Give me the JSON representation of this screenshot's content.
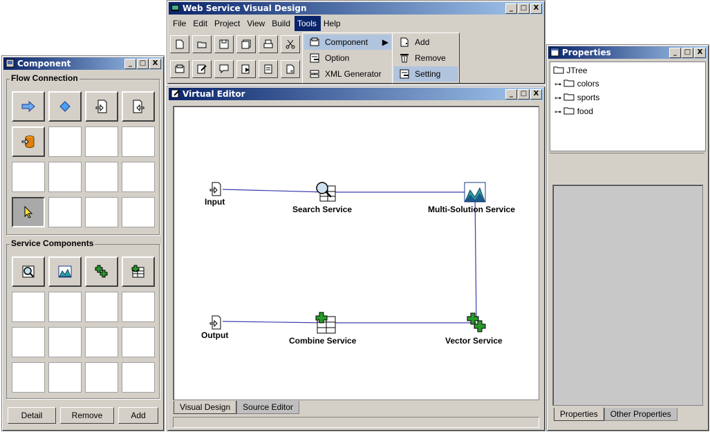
{
  "component_window": {
    "title": "Component",
    "flow_group_label": "Flow Connection",
    "service_group_label": "Service Components",
    "flow_icons": [
      "arrow-right-icon",
      "diamond-icon",
      "import-icon",
      "export-icon",
      "database-import-icon",
      "pointer-icon"
    ],
    "service_icons": [
      "search-service-icon",
      "multi-solution-icon",
      "vector-service-icon",
      "combine-service-icon"
    ],
    "buttons": {
      "detail": "Detail",
      "remove": "Remove",
      "add": "Add"
    }
  },
  "main_window": {
    "title": "Web Service Visual Design",
    "menu": [
      "File",
      "Edit",
      "Project",
      "View",
      "Build",
      "Tools",
      "Help"
    ],
    "active_menu": "Tools"
  },
  "tools_menu": {
    "items": [
      "Component",
      "Option",
      "XML Generator"
    ],
    "submenu": [
      "Add",
      "Remove",
      "Setting"
    ],
    "highlighted_item": "Component",
    "highlighted_subitem": "Setting"
  },
  "editor_window": {
    "title": "Virtual Editor",
    "tabs": [
      "Visual Design",
      "Source Editor"
    ],
    "selected_tab": "Visual Design",
    "nodes": {
      "input": "Input",
      "search": "Search Service",
      "multi": "Multi-Solution Service",
      "output": "Output",
      "combine": "Combine Service",
      "vector": "Vector Service"
    }
  },
  "properties_window": {
    "title": "Properties",
    "tree_root": "JTree",
    "tree_items": [
      "colors",
      "sports",
      "food"
    ],
    "tabs": [
      "Properties",
      "Other Properties"
    ],
    "selected_tab": "Properties"
  },
  "window_buttons": {
    "minimize": "_",
    "maximize": "□",
    "close": "X"
  },
  "colors": {
    "titlebar": "#0a246a",
    "connection_line": "#3a3ab0",
    "canvas": "#ffffff",
    "chrome": "#d4d0c8"
  }
}
